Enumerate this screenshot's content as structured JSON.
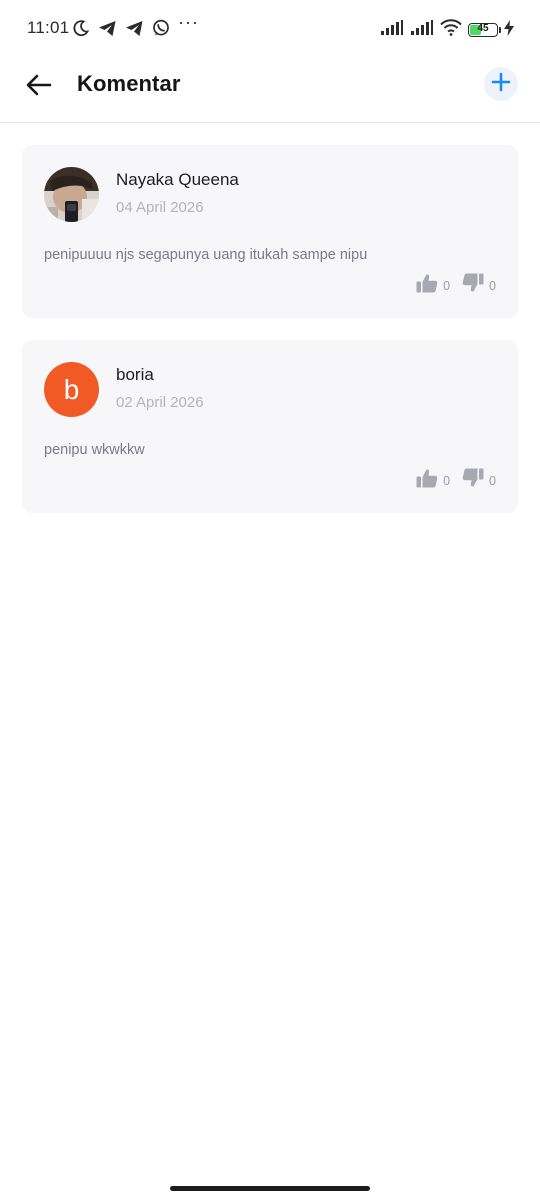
{
  "status_bar": {
    "time": "11:01",
    "more": "···",
    "battery_level": "45",
    "battery_color": "#4cd964",
    "icons": [
      "moon-icon",
      "telegram-icon",
      "telegram-icon",
      "whatsapp-icon",
      "signal-icon",
      "signal-icon",
      "wifi-icon",
      "battery-icon",
      "charging-icon"
    ]
  },
  "app_bar": {
    "title": "Komentar",
    "back_icon": "arrow-left-icon",
    "add_icon": "plus-icon",
    "accent_color": "#1a8cf0"
  },
  "comments": [
    {
      "author": "Nayaka Queena",
      "date": "04 April 2026",
      "text": "penipuuuu njs segapunya uang itukah sampe nipu",
      "avatar_type": "photo",
      "likes": "0",
      "dislikes": "0"
    },
    {
      "author": "boria",
      "date": "02 April 2026",
      "text": "penipu wkwkkw",
      "avatar_type": "letter",
      "avatar_letter": "b",
      "avatar_color": "#f15a24",
      "likes": "0",
      "dislikes": "0"
    }
  ]
}
